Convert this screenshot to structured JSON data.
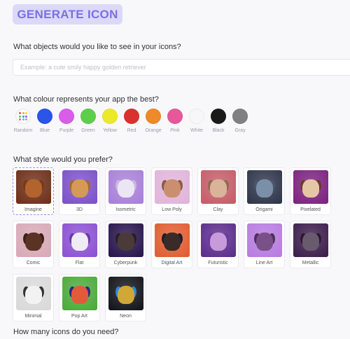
{
  "header": {
    "title": "GENERATE ICON"
  },
  "objects": {
    "question": "What objects would you like to see in your icons?",
    "placeholder": "Example: a cute smily happy golden retriever",
    "value": ""
  },
  "colour": {
    "question": "What colour represents your app the best?",
    "swatches": [
      {
        "label": "Random",
        "color": "#ffffff",
        "random": true
      },
      {
        "label": "Blue",
        "color": "#2b55e8"
      },
      {
        "label": "Purple",
        "color": "#d95de8"
      },
      {
        "label": "Green",
        "color": "#5ccf4a"
      },
      {
        "label": "Yellow",
        "color": "#ecea28"
      },
      {
        "label": "Red",
        "color": "#d8322e"
      },
      {
        "label": "Orange",
        "color": "#ee8a2a"
      },
      {
        "label": "Pink",
        "color": "#e6589a"
      },
      {
        "label": "White",
        "color": "#f7f7f7"
      },
      {
        "label": "Black",
        "color": "#1a1a1a"
      },
      {
        "label": "Gray",
        "color": "#808080"
      }
    ],
    "random_dots": [
      "#e84a4a",
      "#f2a33a",
      "#f2d93a",
      "#54c45a",
      "#3a8ee8",
      "#8a5ae8",
      "#e85ab4",
      "#3ad0d0",
      "#a0a0a0"
    ]
  },
  "style": {
    "question": "What style would you prefer?",
    "selected": "Imagine",
    "options": [
      {
        "label": "Imagine",
        "bg": "#6b2d16",
        "dog": "#b3632d",
        "ear": "#7a3a18"
      },
      {
        "label": "3D",
        "bg": "#7a4fc9",
        "dog": "#d59a55",
        "ear": "#a56a33"
      },
      {
        "label": "Isometric",
        "bg": "#a77ed8",
        "dog": "#ece6f4",
        "ear": "#c7b8e2"
      },
      {
        "label": "Low Poly",
        "bg": "#e0b3d9",
        "dog": "#c98f6f",
        "ear": "#8d5b45"
      },
      {
        "label": "Clay",
        "bg": "#c45a66",
        "dog": "#d9b49a",
        "ear": "#8e6a55"
      },
      {
        "label": "Origami",
        "bg": "#2c3347",
        "dog": "#7a90a8",
        "ear": "#4a566a"
      },
      {
        "label": "Pixelated",
        "bg": "#7a1f7c",
        "dog": "#e5c7a6",
        "ear": "#6b3b2a"
      },
      {
        "label": "Comic",
        "bg": "#d8a8b6",
        "dog": "#5a3324",
        "ear": "#3a2018"
      },
      {
        "label": "Flat",
        "bg": "#8b4fd2",
        "dog": "#f0ecf6",
        "ear": "#6b3aa8"
      },
      {
        "label": "Cyberpunk",
        "bg": "#26124a",
        "dog": "#4a3b3a",
        "ear": "#2a1e22"
      },
      {
        "label": "Digital Art",
        "bg": "#e05b2e",
        "dog": "#3a2a2a",
        "ear": "#1e1e28"
      },
      {
        "label": "Futuristic",
        "bg": "#5a2a8a",
        "dog": "#c79bd9",
        "ear": "#6a3aa0"
      },
      {
        "label": "Line Art",
        "bg": "#b67ae0",
        "dog": "#7a5088",
        "ear": "#4a3058"
      },
      {
        "label": "Metallic",
        "bg": "#3a1a4a",
        "dog": "#6a5a6e",
        "ear": "#2a1a2e"
      },
      {
        "label": "Minimal",
        "bg": "#d9d9d9",
        "dog": "#f2f2f2",
        "ear": "#333333"
      },
      {
        "label": "Pop Art",
        "bg": "#4aa83a",
        "dog": "#e35a3a",
        "ear": "#2a2a8a"
      },
      {
        "label": "Neon",
        "bg": "#101018",
        "dog": "#d0a838",
        "ear": "#2a88e0"
      }
    ]
  },
  "count": {
    "question": "How many icons do you need?"
  }
}
